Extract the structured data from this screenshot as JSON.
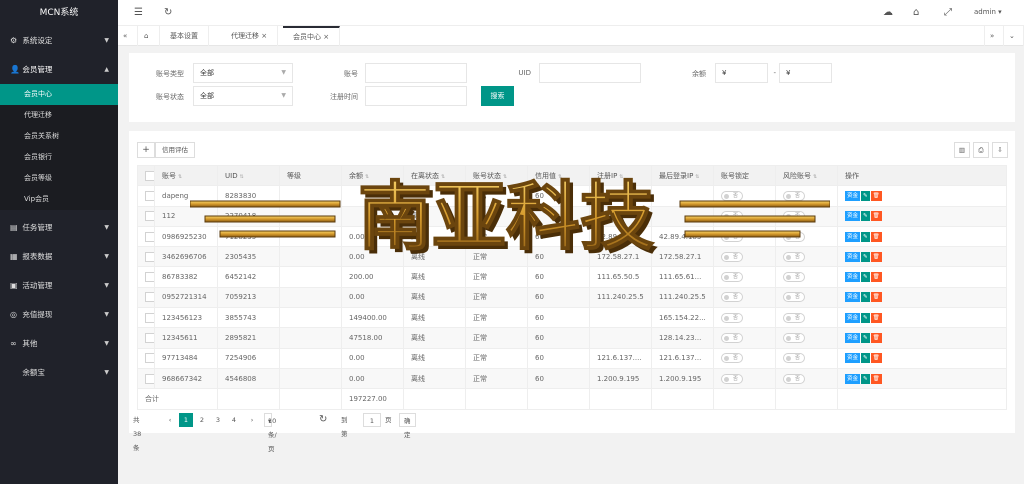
{
  "sidebar": {
    "title": "MCN系统",
    "menus": [
      {
        "label": "系统设定",
        "icon": "gear-icon"
      },
      {
        "label": "会员管理",
        "icon": "users-icon"
      },
      {
        "label": "任务管理",
        "icon": "task-icon"
      },
      {
        "label": "报表数据",
        "icon": "report-icon"
      },
      {
        "label": "活动管理",
        "icon": "activity-icon"
      },
      {
        "label": "充值提现",
        "icon": "wallet-icon"
      },
      {
        "label": "其他",
        "icon": "other-icon"
      },
      {
        "label": "余额宝",
        "icon": ""
      }
    ],
    "sub_items": [
      "会员中心",
      "代理迁移",
      "会员关系树",
      "会员银行",
      "会员等级",
      "Vip会员"
    ]
  },
  "topbar": {
    "user": "admin"
  },
  "tabs": [
    "基本设置",
    "代理迁移",
    "会员中心"
  ],
  "filters": {
    "account_type_label": "账号类型",
    "account_type_value": "全部",
    "account_label": "账号",
    "uid_label": "UID",
    "balance_label": "余额",
    "balance_min": "¥",
    "balance_sep": "-",
    "balance_max": "¥",
    "account_status_label": "账号状态",
    "account_status_value": "全部",
    "register_time_label": "注册时间",
    "search_button": "搜索"
  },
  "toolbar": {
    "add": "+",
    "credit": "信用评估"
  },
  "table": {
    "columns": [
      "账号",
      "UID",
      "等级",
      "余额",
      "在离状态",
      "账号状态",
      "信用值",
      "注册IP",
      "最后登录IP",
      "账号锁定",
      "风险账号",
      "操作"
    ],
    "rows": [
      [
        "dapeng",
        "8283830",
        "",
        "",
        "",
        "正常",
        "60",
        "",
        "",
        "否",
        "否"
      ],
      [
        "112",
        "2270418",
        "",
        "",
        "离线",
        "",
        "",
        "",
        "",
        "否",
        "否"
      ],
      [
        "0986925230",
        "7128235",
        "",
        "0.00",
        "离线",
        "正常",
        "60",
        "42.89.4.183",
        "42.89.4.183",
        "否",
        "否"
      ],
      [
        "3462696706",
        "2305435",
        "",
        "0.00",
        "离线",
        "正常",
        "60",
        "172.58.27.1",
        "172.58.27.1",
        "否",
        "否"
      ],
      [
        "86783382",
        "6452142",
        "",
        "200.00",
        "离线",
        "正常",
        "60",
        "111.65.50.5",
        "111.65.61...",
        "否",
        "否"
      ],
      [
        "0952721314",
        "7059213",
        "",
        "0.00",
        "离线",
        "正常",
        "60",
        "111.240.25.5",
        "111.240.25.5",
        "否",
        "否"
      ],
      [
        "123456123",
        "3855743",
        "",
        "149400.00",
        "离线",
        "正常",
        "60",
        "",
        "165.154.22...",
        "否",
        "否"
      ],
      [
        "12345611",
        "2895821",
        "",
        "47518.00",
        "离线",
        "正常",
        "60",
        "",
        "128.14.23...",
        "否",
        "否"
      ],
      [
        "97713484",
        "7254906",
        "",
        "0.00",
        "离线",
        "正常",
        "60",
        "121.6.137....",
        "121.6.137...",
        "否",
        "否"
      ],
      [
        "968667342",
        "4546808",
        "",
        "0.00",
        "离线",
        "正常",
        "60",
        "1.200.9.195",
        "1.200.9.195",
        "否",
        "否"
      ]
    ],
    "total_label": "合计",
    "total_value": "197227.00",
    "actions": {
      "fund": "资金",
      "edit": "✎",
      "delete": "🗑"
    }
  },
  "pager": {
    "total": "共 38 条",
    "pages": [
      "1",
      "2",
      "3",
      "4"
    ],
    "per_page": "10 条/页",
    "goto": "到第",
    "page_input": "1",
    "page_unit": "页",
    "confirm": "确定"
  },
  "watermark": "南亚科技",
  "colors": {
    "accent": "#009688",
    "sidebar": "#20222a",
    "fund": "#1e9fff",
    "delete": "#ff5722"
  }
}
